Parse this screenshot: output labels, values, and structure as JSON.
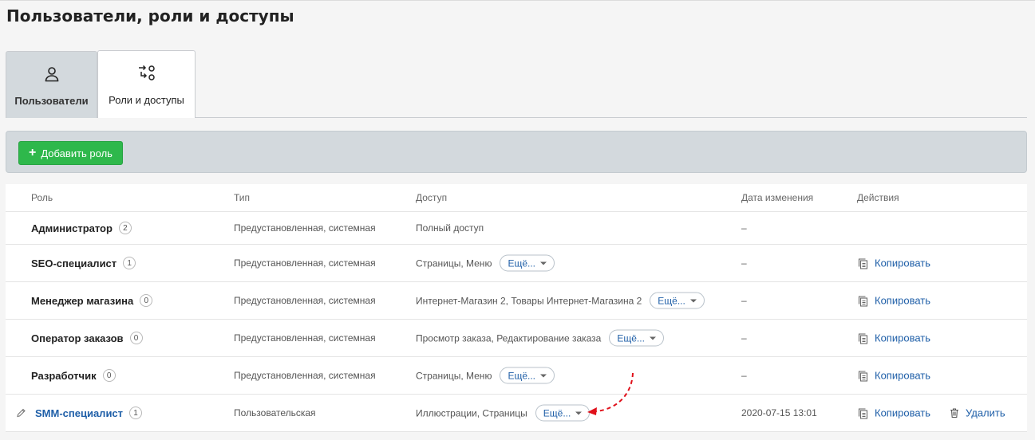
{
  "page": {
    "title": "Пользователи, роли и доступы"
  },
  "tabs": [
    {
      "label": "Пользователи",
      "icon": "user-icon",
      "active": false
    },
    {
      "label": "Роли и доступы",
      "icon": "roles-access-icon",
      "active": true
    }
  ],
  "toolbar": {
    "add_role_label": "Добавить роль"
  },
  "table": {
    "columns": [
      "Роль",
      "Тип",
      "Доступ",
      "Дата изменения",
      "Действия"
    ],
    "rows": [
      {
        "role": "Администратор",
        "count": "2",
        "type": "Предустановленная, системная",
        "access": "Полный доступ",
        "more": "",
        "date": "–",
        "copy": "",
        "delete": ""
      },
      {
        "role": "SEO-специалист",
        "count": "1",
        "type": "Предустановленная, системная",
        "access": "Страницы, Меню",
        "more": "Ещё...",
        "date": "–",
        "copy": "Копировать",
        "delete": ""
      },
      {
        "role": "Менеджер магазина",
        "count": "0",
        "type": "Предустановленная, системная",
        "access": "Интернет-Магазин 2, Товары Интернет-Магазина 2",
        "more": "Ещё...",
        "date": "–",
        "copy": "Копировать",
        "delete": ""
      },
      {
        "role": "Оператор заказов",
        "count": "0",
        "type": "Предустановленная, системная",
        "access": "Просмотр заказа, Редактирование заказа",
        "more": "Ещё...",
        "date": "–",
        "copy": "Копировать",
        "delete": ""
      },
      {
        "role": "Разработчик",
        "count": "0",
        "type": "Предустановленная, системная",
        "access": "Страницы, Меню",
        "more": "Ещё...",
        "date": "–",
        "copy": "Копировать",
        "delete": ""
      },
      {
        "role": "SMM-специалист",
        "count": "1",
        "type": "Пользовательская",
        "access": "Иллюстрации, Страницы",
        "more": "Ещё...",
        "date": "2020-07-15 13:01",
        "copy": "Копировать",
        "delete": "Удалить"
      }
    ]
  },
  "colors": {
    "accent_green": "#2eb84b",
    "link_blue": "#1f5fa8",
    "annotation_red": "#e0101a"
  }
}
